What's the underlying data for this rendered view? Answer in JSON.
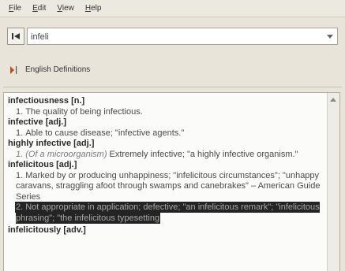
{
  "menu": {
    "items": [
      {
        "first": "F",
        "rest": "ile"
      },
      {
        "first": "E",
        "rest": "dit"
      },
      {
        "first": "V",
        "rest": "iew"
      },
      {
        "first": "H",
        "rest": "elp"
      }
    ]
  },
  "search": {
    "value": "infeli"
  },
  "source": {
    "label": "English Definitions"
  },
  "entries": {
    "infectiousness": {
      "headword": "infectiousness",
      "pos": "[n.]",
      "senses": [
        {
          "num": "1.",
          "text": "The quality of being infectious."
        }
      ]
    },
    "infective": {
      "headword": "infective",
      "pos": "[adj.]",
      "senses": [
        {
          "num": "1.",
          "text": "Able to cause disease; \"infective agents.\""
        }
      ]
    },
    "highly_infective": {
      "headword": "highly infective",
      "pos": "[adj.]",
      "senses": [
        {
          "num": "1.",
          "italic": "(Of a microorganism)",
          "text": " Extremely infective; \"a highly infective organism.\""
        }
      ]
    },
    "infelicitous": {
      "headword": "infelicitous",
      "pos": "[adj.]",
      "sense1": {
        "num": "1.",
        "text": "Marked by or producing unhappiness; \"infelicitous circumstances\"; \"unhappy caravans, straggling afoot through swamps and canebrakes\" – American Guide Series"
      },
      "sense2": {
        "num": "2.",
        "text": "Not appropriate in application; defective; \"an infelicitous remark\"; \"infelicitous phrasing\"; \"the infelicitous typesetting"
      }
    },
    "infelicitously": {
      "headword": "infelicitously",
      "pos": "[adv.]"
    }
  }
}
